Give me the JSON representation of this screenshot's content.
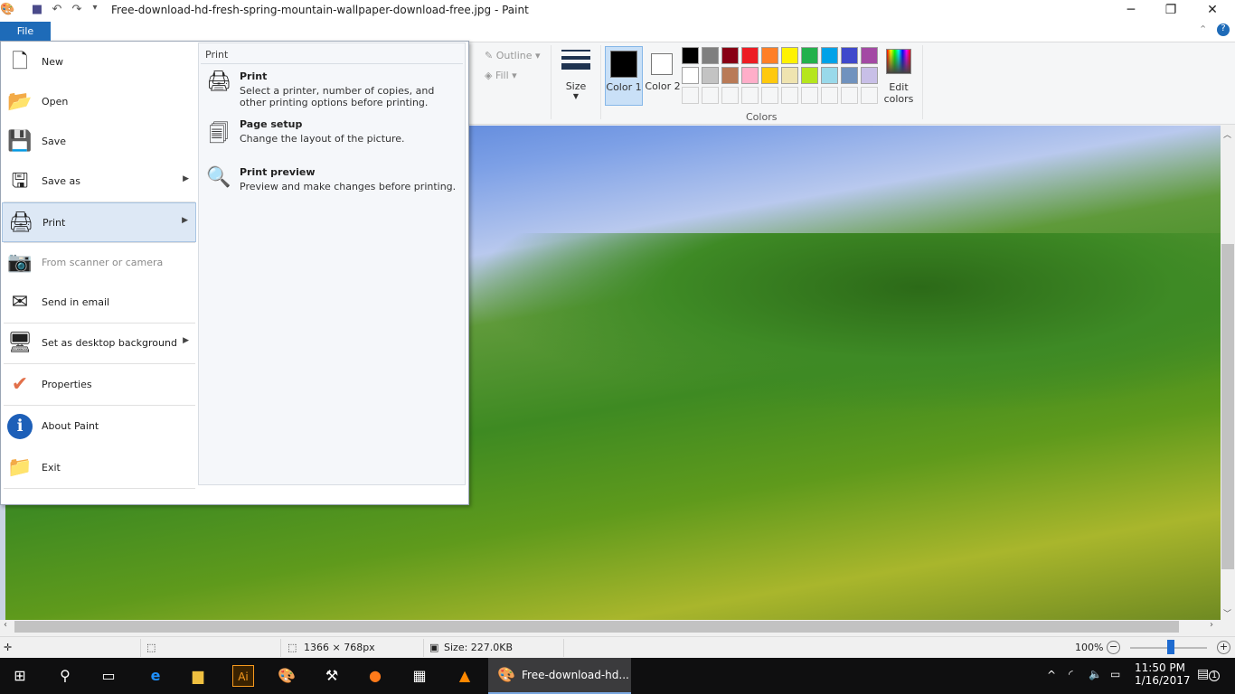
{
  "window": {
    "title": "Free-download-hd-fresh-spring-mountain-wallpaper-download-free.jpg - Paint",
    "minimize": "─",
    "maximize": "❐",
    "close": "✕",
    "help": "?",
    "collapse": "⌃"
  },
  "quick_access": {
    "save_icon": "floppy",
    "undo_icon": "undo",
    "redo_icon": "redo",
    "customize": "▾"
  },
  "file_tab": "File",
  "ribbon": {
    "outline": "Outline",
    "fill": "Fill",
    "size": "Size",
    "color1": "Color 1",
    "color2": "Color 2",
    "edit_colors": "Edit colors",
    "colors_group": "Colors",
    "palette_row1": [
      "#000000",
      "#7f7f7f",
      "#880015",
      "#ed1c24",
      "#ff7f27",
      "#fff200",
      "#22b14c",
      "#00a2e8",
      "#3f48cc",
      "#a349a4"
    ],
    "palette_row2": [
      "#ffffff",
      "#c3c3c3",
      "#b97a57",
      "#ffaec9",
      "#ffc90e",
      "#efe4b0",
      "#b5e61d",
      "#99d9ea",
      "#7092be",
      "#c8bfe7"
    ],
    "color1_value": "#000000",
    "color2_value": "#ffffff"
  },
  "file_menu": {
    "items": [
      {
        "label": "New",
        "icon": "new-file-icon"
      },
      {
        "label": "Open",
        "icon": "open-folder-icon"
      },
      {
        "label": "Save",
        "icon": "save-icon"
      },
      {
        "label": "Save as",
        "icon": "save-as-icon",
        "submenu": true
      },
      {
        "label": "Print",
        "icon": "printer-icon",
        "submenu": true,
        "selected": true
      },
      {
        "label": "From scanner or camera",
        "icon": "scanner-icon",
        "disabled": true
      },
      {
        "label": "Send in email",
        "icon": "email-icon"
      },
      {
        "label": "Set as desktop background",
        "icon": "desktop-icon",
        "submenu": true
      },
      {
        "label": "Properties",
        "icon": "checkmark-icon"
      },
      {
        "label": "About Paint",
        "icon": "info-icon"
      },
      {
        "label": "Exit",
        "icon": "exit-icon"
      }
    ],
    "submenu": {
      "title": "Print",
      "items": [
        {
          "title": "Print",
          "desc": "Select a printer, number of copies, and other printing options before printing."
        },
        {
          "title": "Page setup",
          "desc": "Change the layout of the picture."
        },
        {
          "title": "Print preview",
          "desc": "Preview and make changes before printing."
        }
      ]
    }
  },
  "status": {
    "dimensions": "1366 × 768px",
    "size": "Size: 227.0KB",
    "zoom": "100%",
    "zoom_level_percent": 100
  },
  "taskbar": {
    "active_app": "Free-download-hd...",
    "time": "11:50 PM",
    "date": "1/16/2017",
    "notifications": "1"
  }
}
